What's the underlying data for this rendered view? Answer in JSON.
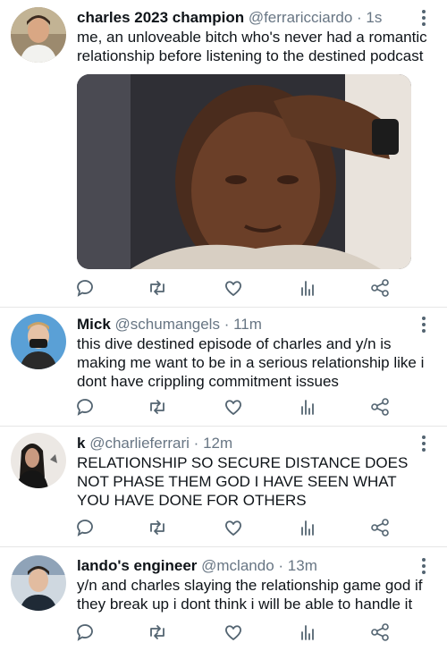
{
  "tweets": [
    {
      "name": "charles 2023 champion",
      "handle": "@ferraricciardo",
      "sep": "·",
      "time": "1s",
      "text": "me, an unloveable bitch who's never had a romantic relationship before listening to the destined podcast",
      "has_media": true
    },
    {
      "name": "Mick",
      "handle": "@schumangels",
      "sep": "·",
      "time": "11m",
      "text": "this dive destined episode of charles and y/n is making me want to be in a serious relationship like i dont have crippling commitment issues"
    },
    {
      "name": "k",
      "handle": "@charlieferrari",
      "sep": "·",
      "time": "12m",
      "text": "RELATIONSHIP SO SECURE DISTANCE DOES NOT PHASE THEM GOD I HAVE SEEN WHAT YOU HAVE DONE FOR OTHERS"
    },
    {
      "name": "lando's engineer",
      "handle": "@mclando",
      "sep": "·",
      "time": "13m",
      "text": "y/n and charles slaying the relationship game god if they break up i dont think i will be able to handle it"
    }
  ],
  "icons": {
    "reply": "reply-icon",
    "retweet": "retweet-icon",
    "like": "heart-icon",
    "analytics": "analytics-icon",
    "share": "share-icon",
    "more": "more-options-icon"
  },
  "colors": {
    "icon": "#536471",
    "secondary_text": "#687684",
    "divider": "#e6e6e6"
  }
}
